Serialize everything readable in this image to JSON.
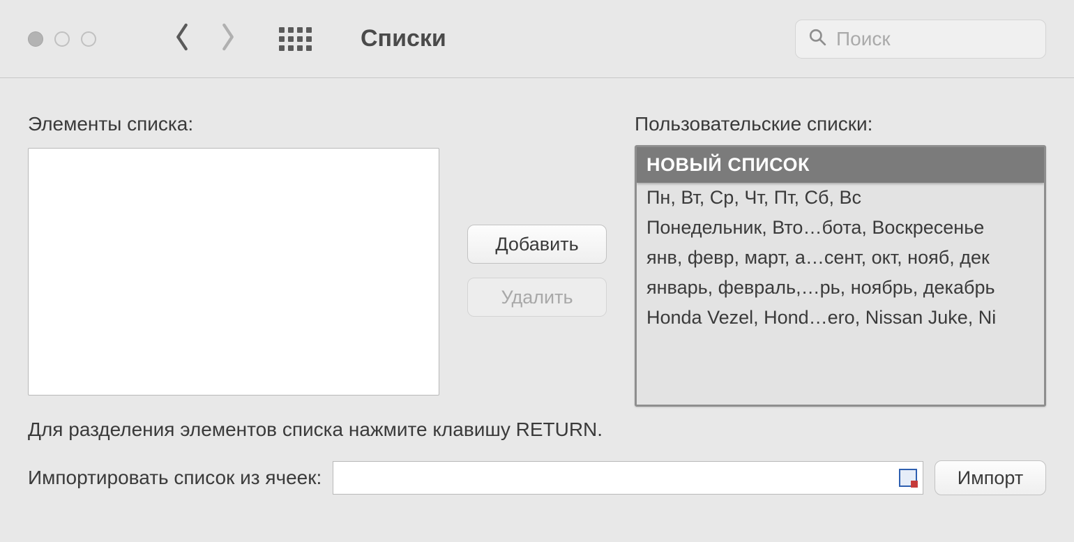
{
  "toolbar": {
    "title": "Списки",
    "search_placeholder": "Поиск"
  },
  "labels": {
    "elements": "Элементы списка:",
    "custom_lists": "Пользовательские списки:",
    "hint": "Для разделения элементов списка нажмите клавишу RETURN.",
    "import_from_cells": "Импортировать список из ячеек:"
  },
  "buttons": {
    "add": "Добавить",
    "delete": "Удалить",
    "import": "Импорт"
  },
  "custom_lists": [
    {
      "text": "НОВЫЙ СПИСОК",
      "selected": true
    },
    {
      "text": "Пн, Вт, Ср, Чт, Пт, Сб, Вс",
      "selected": false
    },
    {
      "text": "Понедельник, Вто…бота, Воскресенье",
      "selected": false
    },
    {
      "text": "янв, февр, март, а…сент, окт, нояб, дек",
      "selected": false
    },
    {
      "text": "январь, февраль,…рь, ноябрь, декабрь",
      "selected": false
    },
    {
      "text": "Honda Vezel, Hond…ero, Nissan Juke, Ni",
      "selected": false
    }
  ]
}
